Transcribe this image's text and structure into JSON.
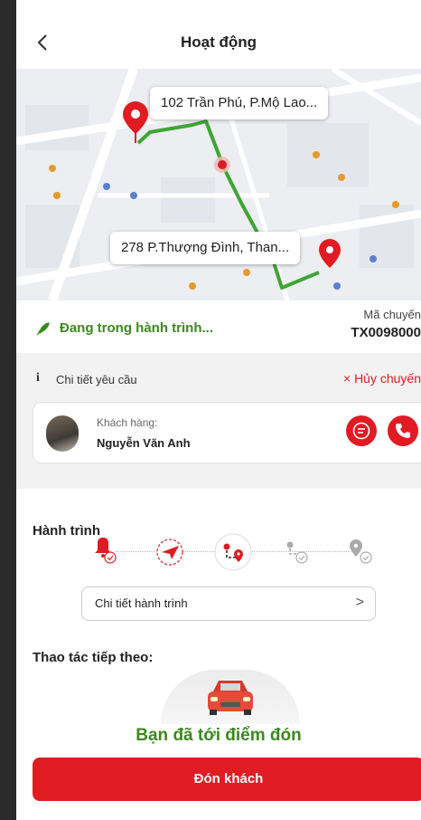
{
  "header": {
    "back_icon": "chevron-left-icon",
    "title": "Hoạt động"
  },
  "map": {
    "pickup_address": "102 Trần Phú, P.Mộ Lao...",
    "dropoff_address": "278 P.Thượng Đình, Than...",
    "route_color": "#3fa535",
    "pin_color": "#e11b22"
  },
  "status": {
    "icon": "rocket-icon",
    "text": "Đang trong hành trình...",
    "code_label": "Mã chuyến",
    "code_value": "TX0098000"
  },
  "request": {
    "info_icon": "info-icon",
    "label": "Chi tiết yêu cầu",
    "cancel_label": "× Hủy chuyến",
    "customer_label": "Khách hàng:",
    "customer_name": "Nguyễn Văn Anh"
  },
  "journey": {
    "title": "Hành trình",
    "steps": [
      "bell-check-icon",
      "send-icon",
      "route-pin-icon",
      "route-check-icon",
      "pin-check-icon"
    ],
    "active_step": 3,
    "detail_label": "Chi tiết hành trình",
    "detail_chevron": ">"
  },
  "next_action": {
    "title": "Thao tác tiếp theo:",
    "status_text": "Bạn đã tới điểm đón",
    "button_label": "Đón khách"
  },
  "colors": {
    "accent": "#e11b22",
    "success": "#3a8a1c"
  }
}
